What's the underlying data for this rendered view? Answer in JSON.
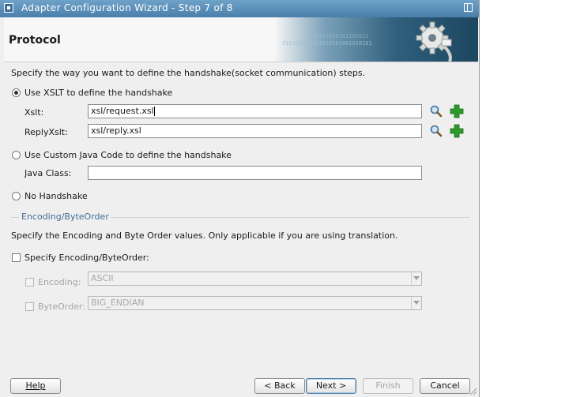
{
  "window": {
    "title": "Adapter Configuration Wizard - Step 7 of 8"
  },
  "header": {
    "page_title": "Protocol",
    "banner_binary_1": "010101010101010101001010101",
    "banner_binary_2": "0101010101101011"
  },
  "instructions": "Specify the way you want to define the handshake(socket communication) steps.",
  "options": {
    "xslt": {
      "label": "Use XSLT to define the handshake",
      "selected": true
    },
    "custom_java": {
      "label": "Use Custom Java Code to define the handshake",
      "selected": false
    },
    "no_handshake": {
      "label": "No Handshake",
      "selected": false
    }
  },
  "xslt_fields": {
    "xslt_label": "Xslt:",
    "xslt_value": "xsl/request.xsl",
    "reply_label": "ReplyXslt:",
    "reply_value": "xsl/reply.xsl"
  },
  "java_fields": {
    "class_label": "Java Class:",
    "class_value": ""
  },
  "encoding_section": {
    "legend": "Encoding/ByteOrder",
    "description": "Specify the Encoding and Byte Order values. Only applicable if you are using translation.",
    "specify_label": "Specify Encoding/ByteOrder:",
    "specify_checked": false,
    "encoding_label": "Encoding:",
    "encoding_value": "ASCII",
    "byteorder_label": "ByteOrder:",
    "byteorder_value": "BIG_ENDIAN"
  },
  "icons": {
    "browse": "search-icon",
    "create": "plus-icon",
    "accent_green": "#2c9a2c"
  },
  "buttons": {
    "help": "Help",
    "back": "< Back",
    "next": "Next >",
    "finish": "Finish",
    "cancel": "Cancel"
  }
}
